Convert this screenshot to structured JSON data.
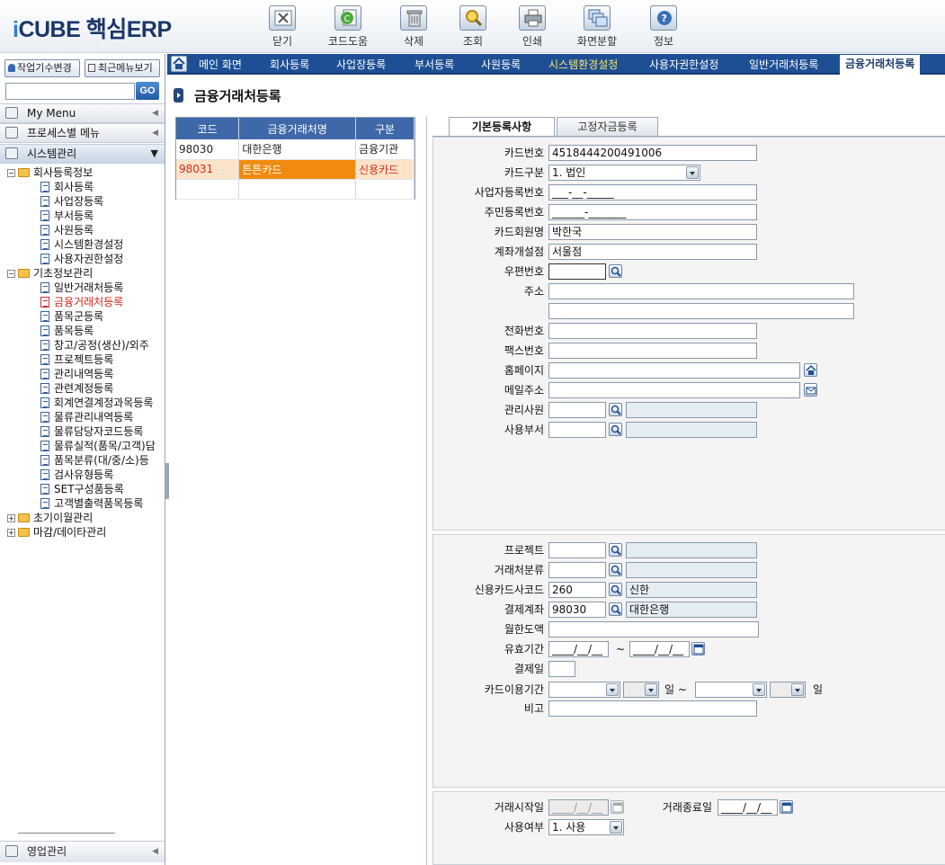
{
  "app": {
    "logo_prefix": "i",
    "logo_text": "CUBE 핵심ERP",
    "toolbar": [
      {
        "label": "닫기",
        "icon": "close-icon"
      },
      {
        "label": "코드도움",
        "icon": "help-code-icon"
      },
      {
        "label": "삭제",
        "icon": "trash-icon"
      },
      {
        "label": "조회",
        "icon": "search-icon"
      },
      {
        "label": "인쇄",
        "icon": "printer-icon"
      },
      {
        "label": "화면분할",
        "icon": "split-screen-icon"
      },
      {
        "label": "정보",
        "icon": "info-icon"
      }
    ]
  },
  "left": {
    "btn_work_change": "작업기수변경",
    "btn_recent_menu": "최근메뉴보기",
    "search_value": "",
    "go_label": "GO",
    "my_menu": "My Menu",
    "process_menu": "프로세스별 메뉴",
    "system_mgmt": "시스템관리",
    "tree": {
      "company_reg_info": "회사등록정보",
      "company_reg": "회사등록",
      "biz_reg": "사업장등록",
      "dept_reg": "부서등록",
      "emp_reg": "사원등록",
      "sys_env": "시스템환경설정",
      "user_auth": "사용자권한설정",
      "basic_info": "기초정보관리",
      "general_client": "일반거래처등록",
      "finance_client": "금융거래처등록",
      "item_group": "품목군등록",
      "item_reg": "품목등록",
      "warehouse": "창고/공정(생산)/외주",
      "project_reg": "프로젝트등록",
      "mgmt_detail": "관리내역등록",
      "related_acct": "관련계정등록",
      "acct_link": "회계연결계정과목등록",
      "logistics_detail": "물류관리내역등록",
      "logistics_manager": "물류담당자코드등록",
      "logistics_perf": "물류실적(품목/고객)담",
      "item_class": "품목분류(대/중/소)등",
      "inspection_type": "검사유형등록",
      "set_item": "SET구성품등록",
      "customer_print": "고객별출력품목등록",
      "init_carry": "초기이월관리",
      "closing_data": "마감/데이타관리"
    },
    "sales_mgmt": "영업관리"
  },
  "tabs": {
    "main": "메인 화면",
    "company": "회사등록",
    "biz": "사업장등록",
    "dept": "부서등록",
    "emp": "사원등록",
    "sysenv": "시스템환경설정",
    "userauth": "사용자권한설정",
    "general": "일반거래처등록",
    "finance": "금융거래처등록"
  },
  "page": {
    "title": "금융거래처등록"
  },
  "grid": {
    "headers": [
      "코드",
      "금융거래처명",
      "구분"
    ],
    "rows": [
      [
        "98030",
        "대한은행",
        "금융기관"
      ],
      [
        "98031",
        "튼튼카드",
        "신용카드"
      ]
    ]
  },
  "form_tabs": {
    "basic": "기본등록사항",
    "fixed_fund": "고정자금등록"
  },
  "form": {
    "card_no_label": "카드번호",
    "card_no": "4518444200491006",
    "card_type_label": "카드구분",
    "card_type": "1. 법인",
    "biz_no_label": "사업자등록번호",
    "biz_no": "___-__-_____",
    "resident_no_label": "주민등록번호",
    "resident_no": "______-_______",
    "member_label": "카드회원명",
    "member": "박한국",
    "branch_label": "계좌개설점",
    "branch": "서울점",
    "zip_label": "우편번호",
    "zip": "",
    "address_label": "주소",
    "address1": "",
    "address2": "",
    "phone_label": "전화번호",
    "phone": "",
    "fax_label": "팩스번호",
    "fax": "",
    "homepage_label": "홈페이지",
    "homepage": "",
    "email_label": "메일주소",
    "email": "",
    "manager_label": "관리사원",
    "manager": "",
    "manager_name": "",
    "dept_label": "사용부서",
    "dept": "",
    "dept_name": ""
  },
  "form2": {
    "project_label": "프로젝트",
    "project": "",
    "project_name": "",
    "client_class_label": "거래처분류",
    "client_class": "",
    "client_class_name": "",
    "card_co_label": "신용카드사코드",
    "card_co": "260",
    "card_co_name": "신한",
    "settle_acct_label": "결제계좌",
    "settle_acct": "98030",
    "settle_acct_name": "대한은행",
    "limit_label": "월한도액",
    "limit": "",
    "valid_label": "유효기간",
    "valid_from": "____/__/__",
    "tilde": "~",
    "valid_to": "____/__/__",
    "pay_day_label": "결제일",
    "pay_day": "",
    "usage_label": "카드이용기간",
    "usage_from": "",
    "day_unit1": "일 ~",
    "usage_to": "",
    "day_unit2": "일",
    "note_label": "비고",
    "note": ""
  },
  "form3": {
    "start_label": "거래시작일",
    "start": "____/__/__",
    "end_label": "거래종료일",
    "end": "____/__/__",
    "use_label": "사용여부",
    "use": "1. 사용"
  }
}
